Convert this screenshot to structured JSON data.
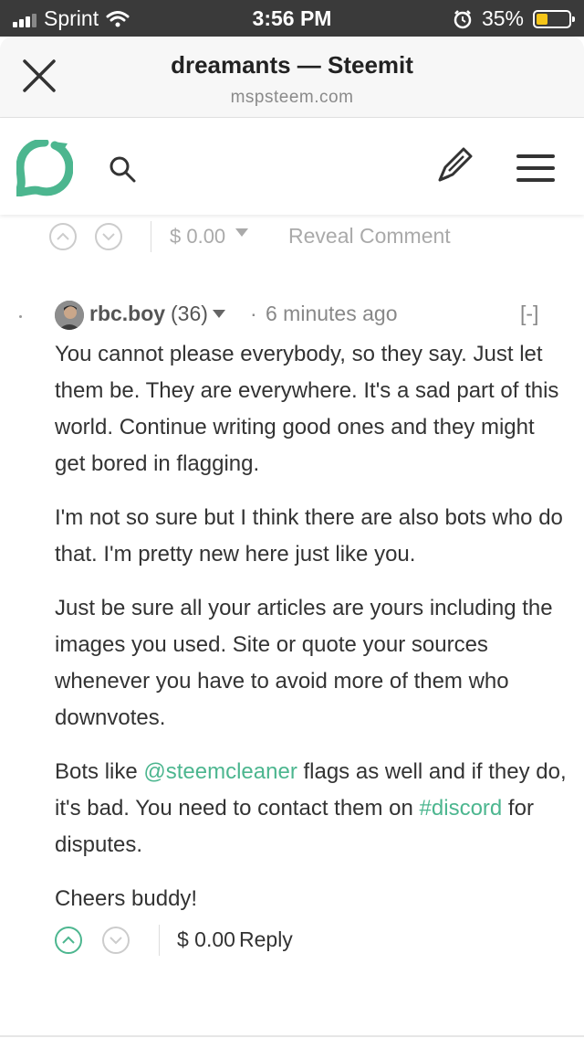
{
  "status_bar": {
    "carrier": "Sprint",
    "time": "3:56 PM",
    "battery": "35%"
  },
  "browser": {
    "title": "dreamants — Steemit",
    "url": "mspsteem.com"
  },
  "top_comment": {
    "payout": "$ 0.00",
    "reveal_label": "Reveal Comment"
  },
  "comment": {
    "author": "rbc.boy",
    "reputation": "(36)",
    "separator": "·",
    "time": "6 minutes ago",
    "collapse_label": "[-]",
    "paragraphs": {
      "p1": "You cannot please everybody, so they say. Just let them be. They are everywhere. It's a sad part of this world. Continue writing good ones and they might get bored in flagging.",
      "p2": "I'm not so sure but I think there are also bots who do that. I'm pretty new here just like you.",
      "p3": "Just be sure all your articles are yours including the images you used. Site or quote your sources whenever you have to avoid more of them who downvotes.",
      "p4_before": "Bots like ",
      "p4_mention": "@steemcleaner",
      "p4_middle": " flags as well and if they do, it's bad. You need to contact them on ",
      "p4_tag": "#discord",
      "p4_after": " for disputes.",
      "p5": "Cheers buddy!"
    },
    "payout": "$ 0.00",
    "reply_label": "Reply"
  },
  "colors": {
    "accent": "#4cb68f",
    "status_bar_bg": "#3a3a3a",
    "battery": "#f5c518"
  }
}
